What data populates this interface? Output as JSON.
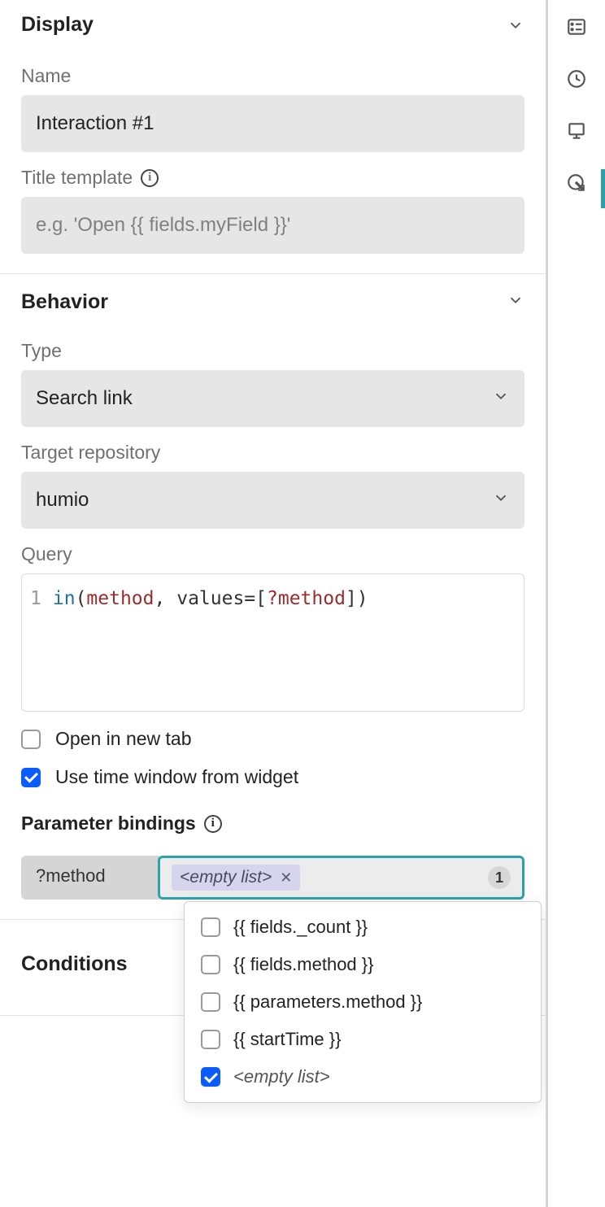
{
  "display": {
    "section_title": "Display",
    "name_label": "Name",
    "name_value": "Interaction #1",
    "title_template_label": "Title template",
    "title_template_placeholder": "e.g. 'Open {{ fields.myField }}'"
  },
  "behavior": {
    "section_title": "Behavior",
    "type_label": "Type",
    "type_value": "Search link",
    "target_repo_label": "Target repository",
    "target_repo_value": "humio",
    "query_label": "Query",
    "query_line_no": "1",
    "query_tokens": {
      "fn": "in",
      "open": "(",
      "arg1": "method",
      "comma": ", ",
      "kw": "values=[",
      "arg2": "?method",
      "close": "])"
    },
    "open_new_tab_label": "Open in new tab",
    "open_new_tab_checked": false,
    "use_time_window_label": "Use time window from widget",
    "use_time_window_checked": true,
    "param_bindings_label": "Parameter bindings",
    "param_key": "?method",
    "param_chip_value": "<empty list>",
    "param_chip_x": "✕",
    "param_count": "1",
    "dropdown_options": [
      {
        "label": "{{ fields._count }}",
        "checked": false,
        "italic": false
      },
      {
        "label": "{{ fields.method }}",
        "checked": false,
        "italic": false
      },
      {
        "label": "{{ parameters.method }}",
        "checked": false,
        "italic": false
      },
      {
        "label": "{{ startTime }}",
        "checked": false,
        "italic": false
      },
      {
        "label": "<empty list>",
        "checked": true,
        "italic": true
      }
    ]
  },
  "conditions": {
    "section_title": "Conditions"
  }
}
